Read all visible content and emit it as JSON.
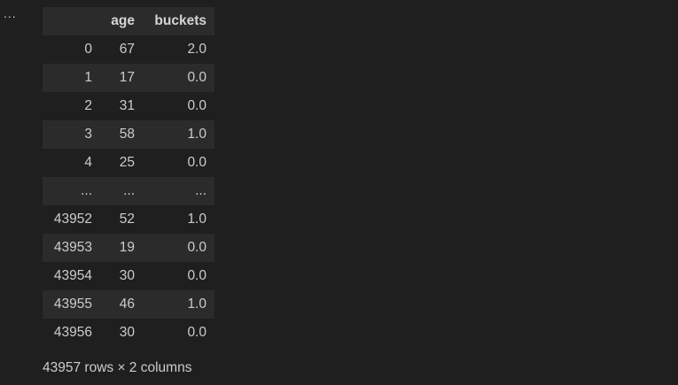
{
  "cell_menu": {
    "label": "..."
  },
  "dataframe": {
    "columns": [
      "",
      "age",
      "buckets"
    ],
    "rows": [
      {
        "index": "0",
        "age": "67",
        "buckets": "2.0"
      },
      {
        "index": "1",
        "age": "17",
        "buckets": "0.0"
      },
      {
        "index": "2",
        "age": "31",
        "buckets": "0.0"
      },
      {
        "index": "3",
        "age": "58",
        "buckets": "1.0"
      },
      {
        "index": "4",
        "age": "25",
        "buckets": "0.0"
      },
      {
        "index": "...",
        "age": "...",
        "buckets": "..."
      },
      {
        "index": "43952",
        "age": "52",
        "buckets": "1.0"
      },
      {
        "index": "43953",
        "age": "19",
        "buckets": "0.0"
      },
      {
        "index": "43954",
        "age": "30",
        "buckets": "0.0"
      },
      {
        "index": "43955",
        "age": "46",
        "buckets": "1.0"
      },
      {
        "index": "43956",
        "age": "30",
        "buckets": "0.0"
      }
    ],
    "shape_text": "43957 rows × 2 columns"
  },
  "colors": {
    "background": "#1f1f1f",
    "stripe": "#2b2b2b",
    "text": "#cccccc"
  }
}
